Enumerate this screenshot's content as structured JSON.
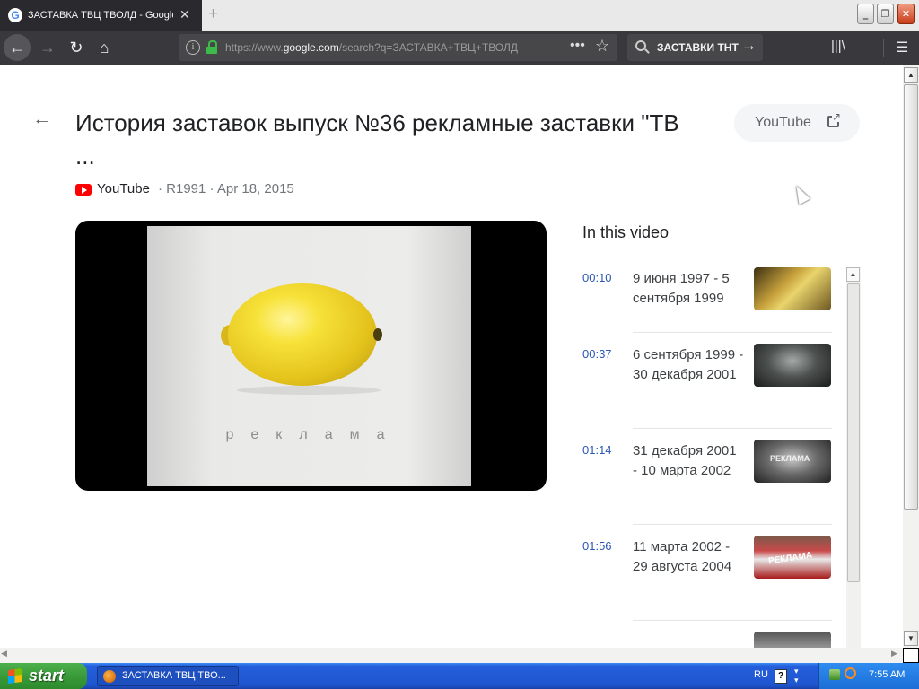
{
  "browser": {
    "tab_title": "ЗАСТАВКА ТВЦ ТВОЛД - Google S",
    "new_tab_symbol": "+",
    "url_prefix": "https://www.",
    "url_domain": "google.com",
    "url_rest": "/search?q=ЗАСТАВКА+ТВЦ+ТВОЛД",
    "search_query": "ЗАСТАВКИ ТНТ",
    "icons": [
      "google-favicon",
      "close-icon",
      "back-icon",
      "forward-icon",
      "reload-icon",
      "home-icon",
      "info-icon",
      "lock-icon",
      "page-actions-icon",
      "bookmark-star-icon",
      "search-icon",
      "arrow-right-icon",
      "library-icon",
      "sidebar-icon",
      "menu-icon"
    ]
  },
  "video": {
    "title": "История заставок выпуск №36 рекламные заставки \"ТВ ...",
    "source_button": "YouTube",
    "meta_site": "YouTube",
    "meta_rest": "· R1991 · Apr 18, 2015",
    "frame_caption": "реклама"
  },
  "chapters": {
    "heading": "In this video",
    "items": [
      {
        "time": "00:10",
        "label": "9 июня 1997 - 5 сентября 1999"
      },
      {
        "time": "00:37",
        "label": "6 сентября 1999 - 30 декабря 2001"
      },
      {
        "time": "01:14",
        "label": "31 декабря 2001 - 10 марта 2002"
      },
      {
        "time": "01:56",
        "label": "11 марта 2002 - 29 августа 2004"
      }
    ],
    "thumb3_text": "РЕКЛАМА",
    "thumb4_text": "РЕКЛАМА"
  },
  "taskbar": {
    "start_label": "start",
    "task_item": "ЗАСТАВКА ТВЦ ТВО...",
    "language": "RU",
    "help": "?",
    "clock": "7:55 AM"
  },
  "colors": {
    "chrome_dark": "#38383d",
    "tab_active": "#2a2a2e",
    "youtube_red": "#ff0000",
    "timestamp_blue": "#2b57b5",
    "xp_taskbar": "#245edb",
    "xp_start_green": "#3a9a3a"
  }
}
